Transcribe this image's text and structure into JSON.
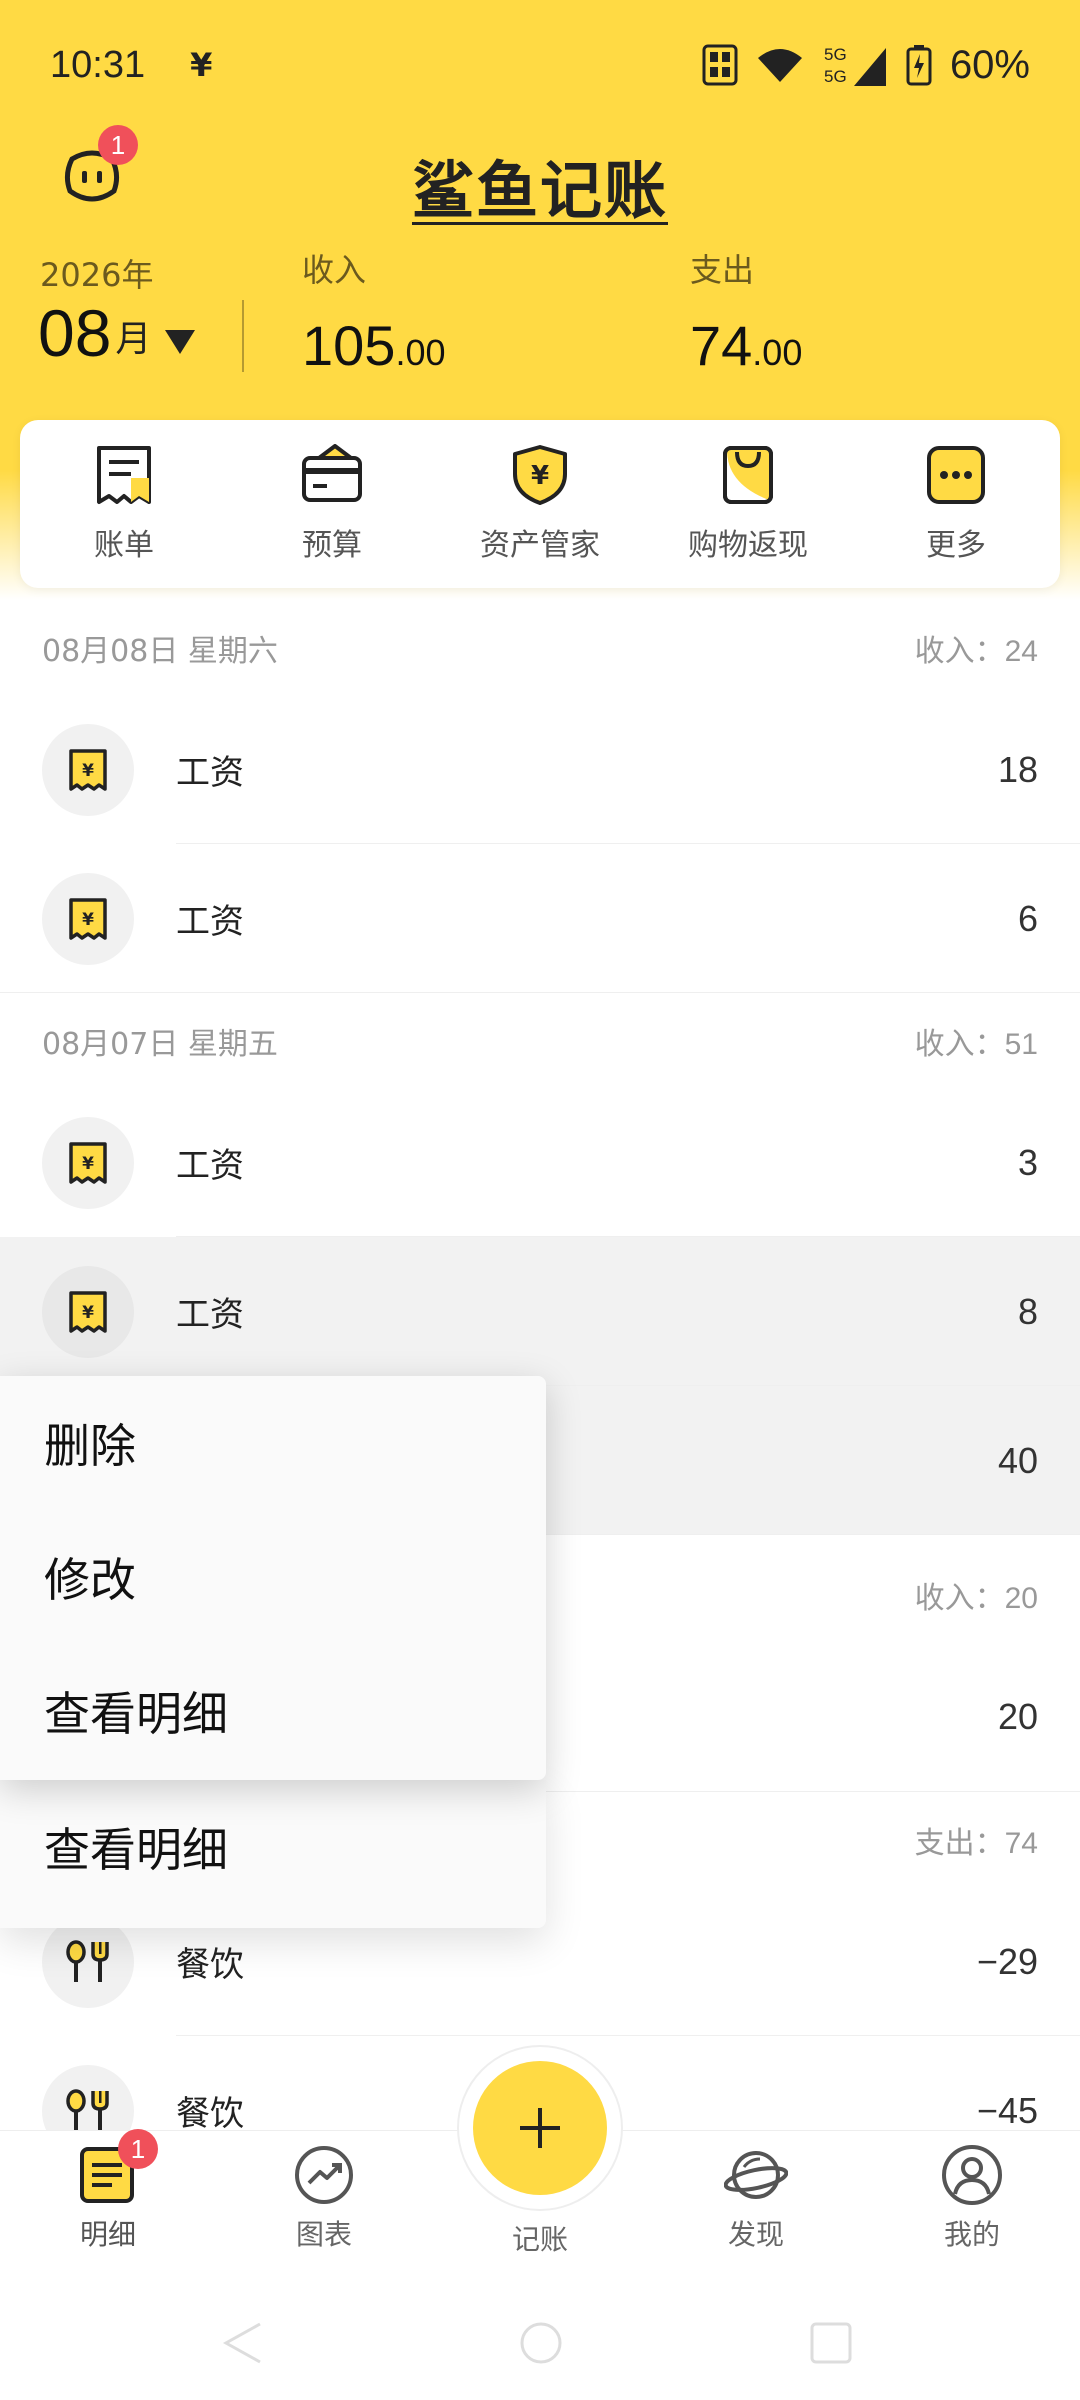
{
  "status_bar": {
    "time": "10:31",
    "yen_notice": "¥",
    "network_label": "5G\n5G",
    "battery": "60%"
  },
  "header": {
    "title": "鲨鱼记账",
    "avatar_badge": "1",
    "year": "2026年",
    "month": "08",
    "month_unit": "月",
    "income_label": "收入",
    "income_int": "105",
    "income_dec": ".00",
    "expense_label": "支出",
    "expense_int": "74",
    "expense_dec": ".00"
  },
  "quick_actions": [
    {
      "label": "账单",
      "icon": "bill-icon"
    },
    {
      "label": "预算",
      "icon": "budget-wallet-icon"
    },
    {
      "label": "资产管家",
      "icon": "asset-shield-icon"
    },
    {
      "label": "购物返现",
      "icon": "shopping-bag-icon"
    },
    {
      "label": "更多",
      "icon": "more-icon"
    }
  ],
  "days": [
    {
      "date": "08月08日 星期六",
      "total_label": "收入：",
      "total_value": "24",
      "rows": [
        {
          "category": "工资",
          "amount": "18"
        },
        {
          "category": "工资",
          "amount": "6"
        }
      ]
    },
    {
      "date": "08月07日 星期五",
      "total_label": "收入：",
      "total_value": "51",
      "rows": [
        {
          "category": "工资",
          "amount": "3"
        },
        {
          "category": "工资",
          "amount": "8"
        },
        {
          "category": "",
          "amount": "40"
        }
      ]
    },
    {
      "date": "",
      "total_label": "收入：",
      "total_value": "20",
      "rows": [
        {
          "category": "",
          "amount": "20"
        }
      ]
    },
    {
      "date": "",
      "total_label": "支出：",
      "total_value": "74",
      "rows": [
        {
          "category": "餐饮",
          "amount": "−29"
        },
        {
          "category": "餐饮",
          "amount": "−45"
        }
      ]
    }
  ],
  "context_menu": {
    "items": [
      "删除",
      "修改",
      "查看明细"
    ],
    "ghost_item": "查看明细"
  },
  "bottom_nav": {
    "items": [
      {
        "label": "明细",
        "badge": "1"
      },
      {
        "label": "图表"
      },
      {
        "label": "记账"
      },
      {
        "label": "发现"
      },
      {
        "label": "我的"
      }
    ]
  },
  "colors": {
    "brand_yellow": "#FFDA44",
    "badge_red": "#F0505A"
  }
}
